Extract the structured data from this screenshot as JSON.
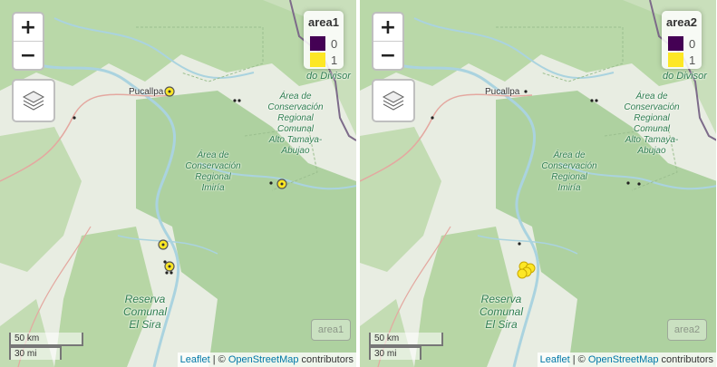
{
  "maps": [
    {
      "legend": {
        "title": "area1",
        "items": [
          {
            "label": "0",
            "color": "#440154"
          },
          {
            "label": "1",
            "color": "#fde725"
          }
        ]
      },
      "overlay_label": "area1",
      "points_value": 1
    },
    {
      "legend": {
        "title": "area2",
        "items": [
          {
            "label": "0",
            "color": "#440154"
          },
          {
            "label": "1",
            "color": "#fde725"
          }
        ]
      },
      "overlay_label": "area2",
      "points_value": 1
    }
  ],
  "controls": {
    "zoom_in": "+",
    "zoom_out": "−"
  },
  "scale": {
    "km": "50 km",
    "mi": "30 mi"
  },
  "attribution": {
    "leaflet": "Leaflet",
    "separator": " | © ",
    "osm": "OpenStreetMap",
    "suffix": " contributors"
  },
  "places": {
    "city": "Pucallpa",
    "area_divisor": "do Divisor",
    "area_tamaya": "Área de\nConservación\nRegional\nComunal\nAlto Tamaya-\nAbujao",
    "area_imiria": "Área de\nConservación\nRegional\nImiría",
    "reserve": "Reserva\nComunal\nEl Sira"
  },
  "colors": {
    "forest": "#aed1a0",
    "river": "#aad3df",
    "border": "#9e8aa8",
    "marker_fill": "#fde725"
  }
}
